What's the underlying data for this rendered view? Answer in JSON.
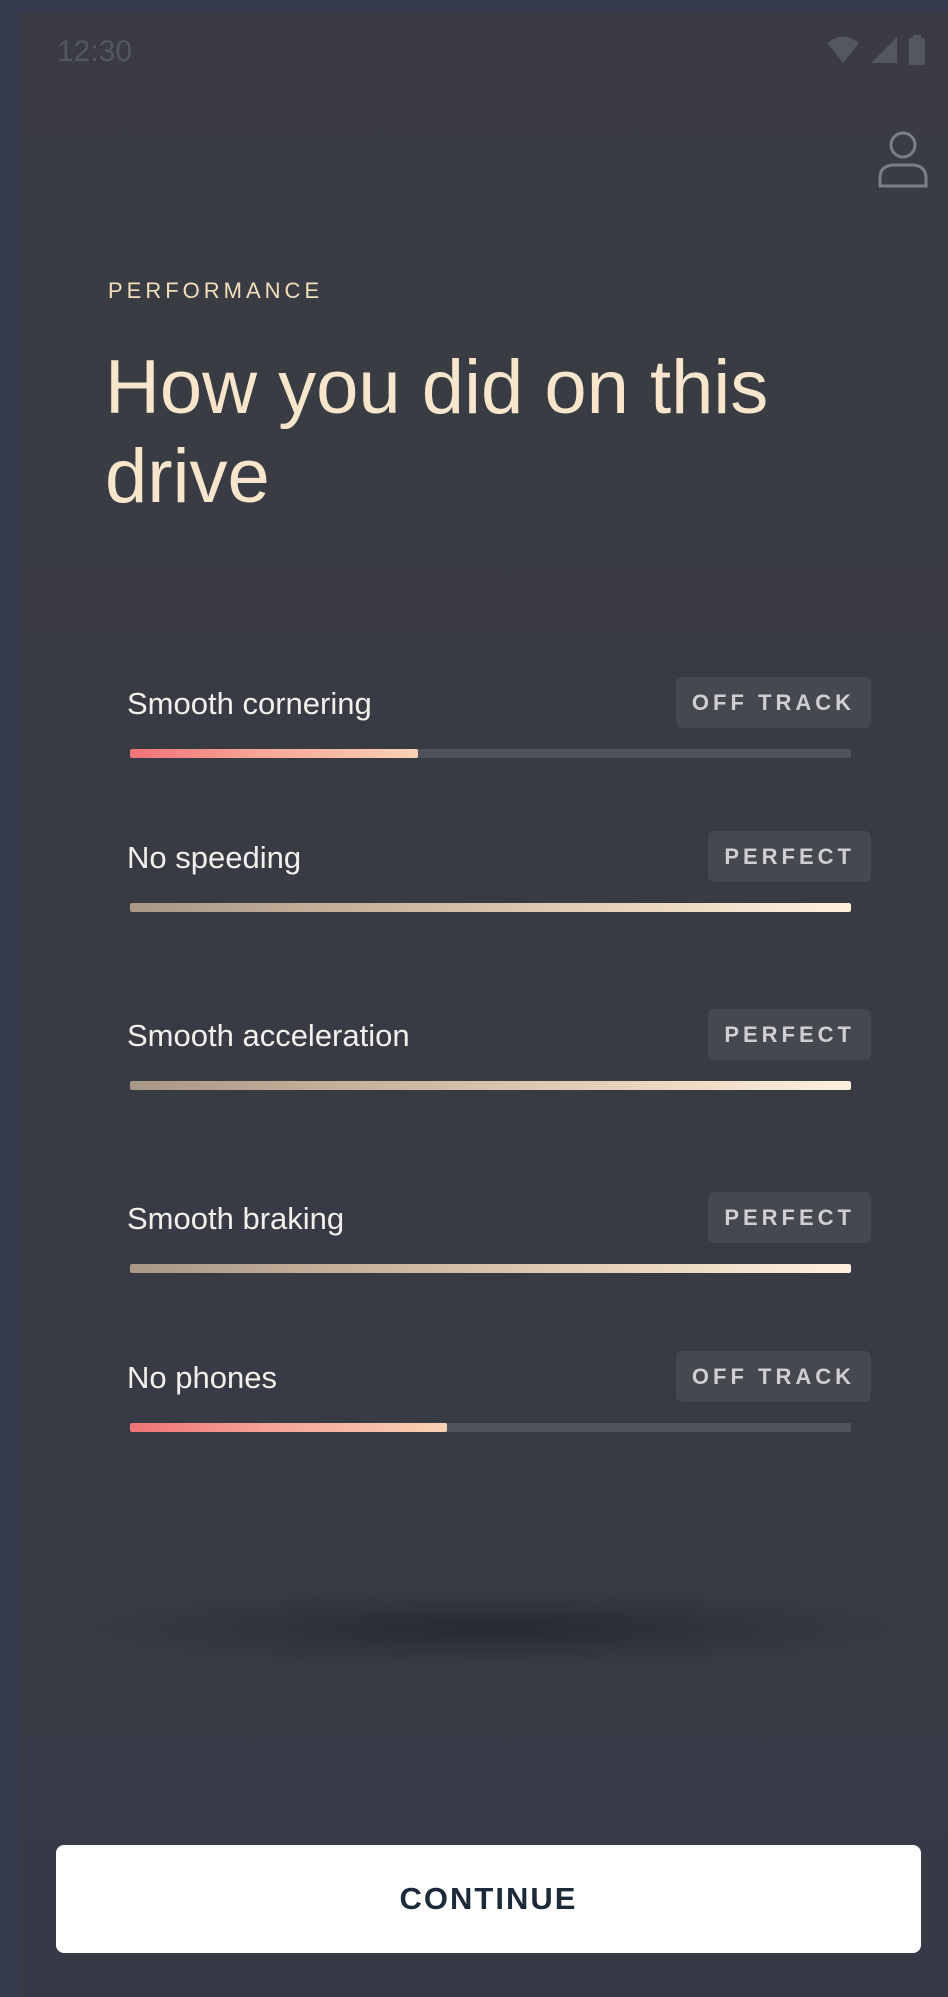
{
  "status_bar": {
    "time": "12:30",
    "icons": [
      "wifi-icon",
      "signal-icon",
      "battery-icon"
    ]
  },
  "header": {
    "profile_icon": "user-icon"
  },
  "performance": {
    "eyebrow": "PERFORMANCE",
    "title": "How you did on this drive",
    "metrics": [
      {
        "label": "Smooth cornering",
        "status": "OFF TRACK",
        "score_percent": 40
      },
      {
        "label": "No speeding",
        "status": "PERFECT",
        "score_percent": 100
      },
      {
        "label": "Smooth acceleration",
        "status": "PERFECT",
        "score_percent": 100
      },
      {
        "label": "Smooth braking",
        "status": "PERFECT",
        "score_percent": 100
      },
      {
        "label": "No phones",
        "status": "OFF TRACK",
        "score_percent": 44
      }
    ]
  },
  "actions": {
    "continue_label": "CONTINUE"
  },
  "colors": {
    "background": "#3a3c45",
    "accent_cream": "#f7e6cc",
    "off_track_start": "#f07277",
    "perfect_end": "#fff0dc",
    "button_text": "#1c2a3a"
  }
}
